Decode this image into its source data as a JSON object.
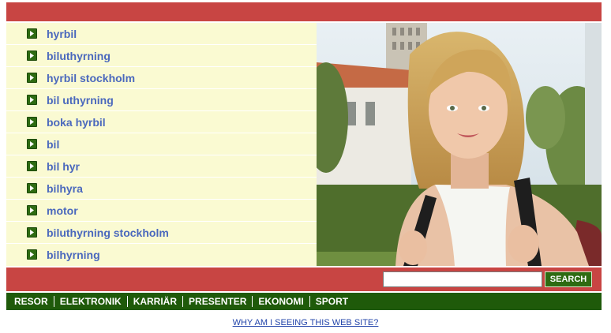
{
  "links": [
    {
      "label": "hyrbil"
    },
    {
      "label": "biluthyrning"
    },
    {
      "label": "hyrbil stockholm"
    },
    {
      "label": "bil uthyrning"
    },
    {
      "label": "boka hyrbil"
    },
    {
      "label": "bil"
    },
    {
      "label": "bil hyr"
    },
    {
      "label": "bilhyra"
    },
    {
      "label": "motor"
    },
    {
      "label": "biluthyrning stockholm"
    },
    {
      "label": "bilhyrning"
    }
  ],
  "search": {
    "value": "",
    "button_label": "SEARCH"
  },
  "nav": {
    "items": [
      {
        "label": "RESOR"
      },
      {
        "label": "ELEKTRONIK"
      },
      {
        "label": "KARRIÄR"
      },
      {
        "label": "PRESENTER"
      },
      {
        "label": "EKONOMI"
      },
      {
        "label": "SPORT"
      }
    ]
  },
  "footer": {
    "why_link": "WHY AM I SEEING THIS WEB SITE?"
  },
  "colors": {
    "accent_red": "#c84543",
    "accent_green": "#1f5a0a",
    "link_blue": "#4a68bd",
    "list_bg": "#fafad2"
  }
}
